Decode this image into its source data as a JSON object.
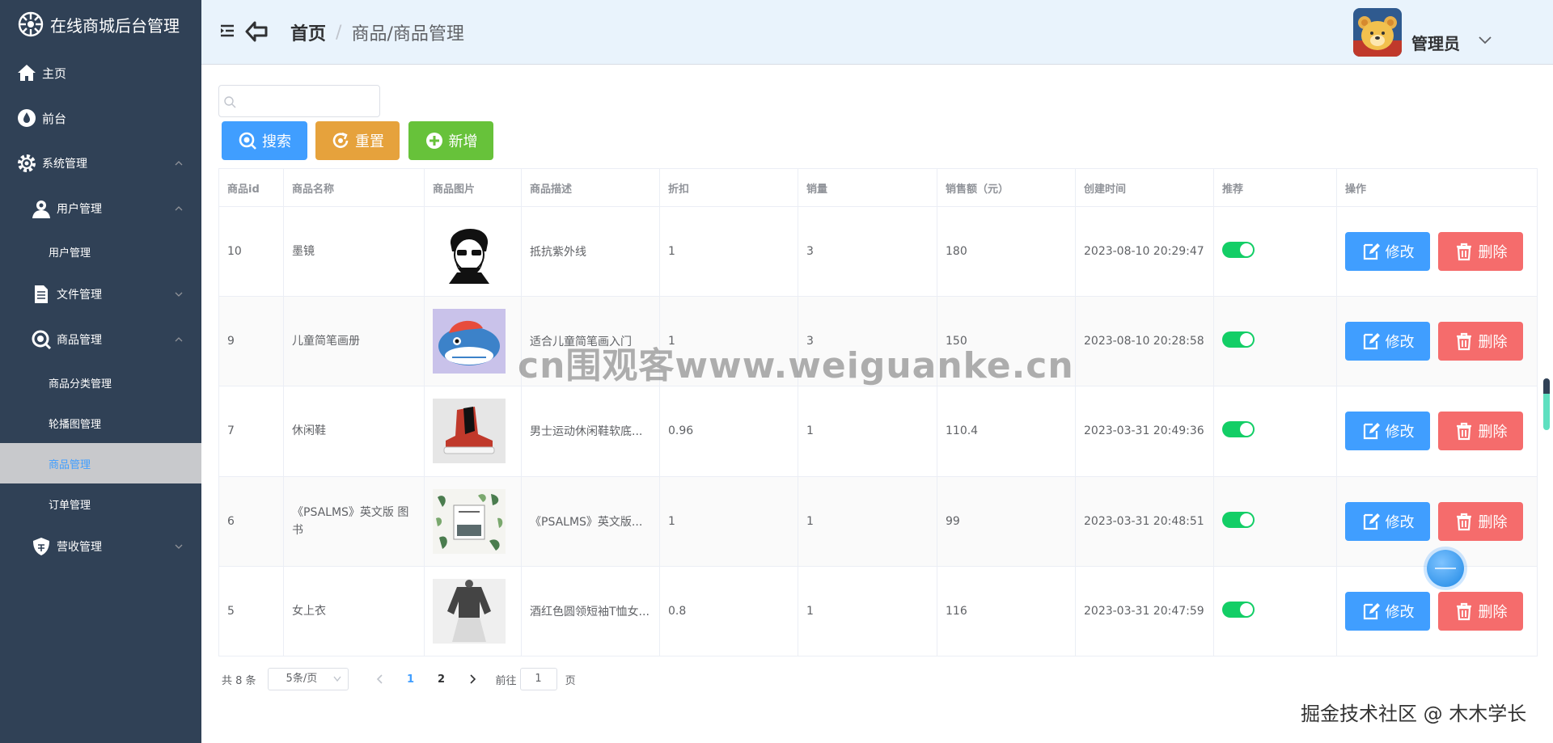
{
  "app": {
    "title": "在线商城后台管理"
  },
  "sidebar": {
    "items": [
      {
        "label": "主页"
      },
      {
        "label": "前台"
      },
      {
        "label": "系统管理"
      },
      {
        "label": "用户管理"
      },
      {
        "label": "用户管理"
      },
      {
        "label": "文件管理"
      },
      {
        "label": "商品管理"
      },
      {
        "label": "商品分类管理"
      },
      {
        "label": "轮播图管理"
      },
      {
        "label": "商品管理"
      },
      {
        "label": "订单管理"
      },
      {
        "label": "营收管理"
      }
    ]
  },
  "header": {
    "breadcrumb": {
      "home": "首页",
      "separator": "/",
      "current": "商品/商品管理"
    },
    "user": {
      "name": "管理员"
    }
  },
  "toolbar": {
    "search_placeholder": "",
    "search_label": "搜索",
    "reset_label": "重置",
    "add_label": "新增"
  },
  "table": {
    "columns": [
      "商品id",
      "商品名称",
      "商品图片",
      "商品描述",
      "折扣",
      "销量",
      "销售额（元）",
      "创建时间",
      "推荐",
      "操作"
    ],
    "rows": [
      {
        "id": "10",
        "name": "墨镜",
        "image": "sunglasses-man",
        "desc": "抵抗紫外线",
        "discount": "1",
        "sales": "3",
        "revenue": "180",
        "created": "2023-08-10  20:29:47",
        "recommended": true
      },
      {
        "id": "9",
        "name": "儿童简笔画册",
        "image": "whale-cartoon",
        "desc": "适合儿童简笔画入门",
        "discount": "1",
        "sales": "3",
        "revenue": "150",
        "created": "2023-08-10  20:28:58",
        "recommended": true
      },
      {
        "id": "7",
        "name": "休闲鞋",
        "image": "red-sneaker",
        "desc": "男士运动休闲鞋软底...",
        "discount": "0.96",
        "sales": "1",
        "revenue": "110.4",
        "created": "2023-03-31  20:49:36",
        "recommended": true
      },
      {
        "id": "6",
        "name": "《PSALMS》英文版 图书",
        "image": "book-leaves",
        "desc": "《PSALMS》英文版...",
        "discount": "1",
        "sales": "1",
        "revenue": "99",
        "created": "2023-03-31  20:48:51",
        "recommended": true
      },
      {
        "id": "5",
        "name": "女上衣",
        "image": "woman-top",
        "desc": "酒红色圆领短袖T恤女...",
        "discount": "0.8",
        "sales": "1",
        "revenue": "116",
        "created": "2023-03-31  20:47:59",
        "recommended": true
      }
    ],
    "edit_label": "修改",
    "delete_label": "删除"
  },
  "pagination": {
    "total": "共 8 条",
    "page_size": "5条/页",
    "pages": [
      "1",
      "2"
    ],
    "current_page": "1",
    "goto_label": "前往",
    "goto_value": "1",
    "page_unit": "页"
  },
  "watermark": {
    "center": "cn围观客www.weiguanke.cn",
    "corner": "掘金技术社区 @ 木木学长"
  },
  "colors": {
    "sidebar_bg": "#304156",
    "primary": "#409eff",
    "warning": "#e6a23c",
    "success": "#67c23a",
    "danger": "#f56c6c",
    "switch_on": "#13ce66"
  }
}
